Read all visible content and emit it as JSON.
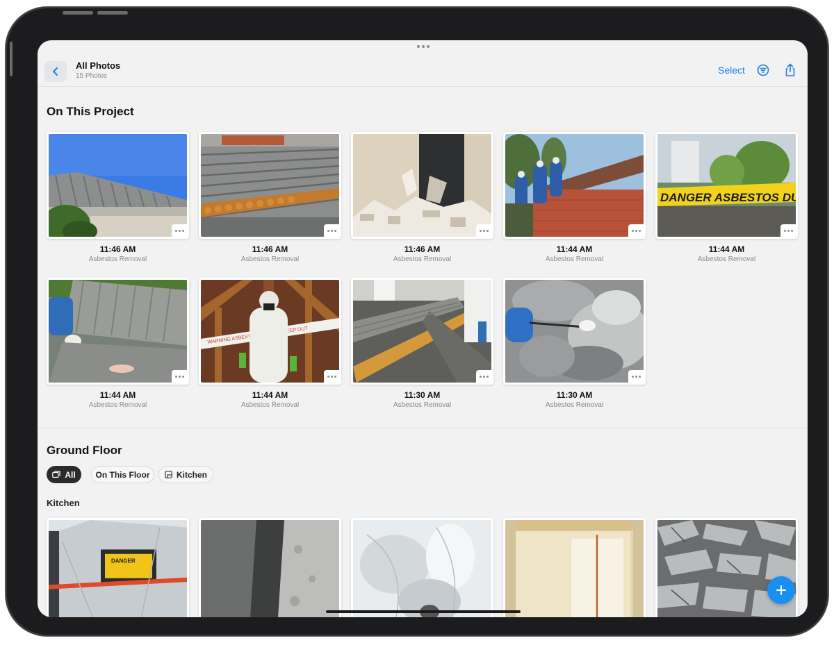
{
  "header": {
    "title": "All Photos",
    "subtitle": "15 Photos",
    "select_label": "Select",
    "back_icon": "chevron-left-icon",
    "filter_icon": "filter-icon",
    "share_icon": "share-icon"
  },
  "project_section": {
    "title": "On This Project",
    "photos": [
      {
        "time": "11:46 AM",
        "tag": "Asbestos Removal",
        "image": "roof-sky"
      },
      {
        "time": "11:46 AM",
        "tag": "Asbestos Removal",
        "image": "roof-corrugated"
      },
      {
        "time": "11:46 AM",
        "tag": "Asbestos Removal",
        "image": "demolished-wall"
      },
      {
        "time": "11:44 AM",
        "tag": "Asbestos Removal",
        "image": "workers-roof"
      },
      {
        "time": "11:44 AM",
        "tag": "Asbestos Removal",
        "image": "danger-tape"
      },
      {
        "time": "11:44 AM",
        "tag": "Asbestos Removal",
        "image": "sheet-removal"
      },
      {
        "time": "11:44 AM",
        "tag": "Asbestos Removal",
        "image": "attic-worker"
      },
      {
        "time": "11:30 AM",
        "tag": "Asbestos Removal",
        "image": "roof-panels"
      },
      {
        "time": "11:30 AM",
        "tag": "Asbestos Removal",
        "image": "tweezers-sample"
      }
    ]
  },
  "ground_floor": {
    "title": "Ground Floor",
    "filters": [
      {
        "label": "All",
        "active": true
      },
      {
        "label": "On This Floor",
        "active": false
      },
      {
        "label": "Kitchen",
        "active": false
      }
    ],
    "subsection_title": "Kitchen",
    "kitchen_photos": [
      {
        "image": "danger-sign-container"
      },
      {
        "image": "concrete-corner"
      },
      {
        "image": "plastic-sheeting"
      },
      {
        "image": "sealed-room"
      },
      {
        "image": "debris-pile"
      }
    ]
  },
  "image_text": {
    "danger_tape": "DANGER ASBESTOS DUST HAZARD",
    "attic_tape": "WARNING ASBESTOS REMOVAL KEEP OUT",
    "danger_sign": "DANGER"
  },
  "colors": {
    "accent": "#1a7fe0",
    "fab": "#1a8ff2",
    "chip_active": "#2b2b2d",
    "background": "#f2f2f2"
  },
  "fab_icon": "plus-icon"
}
